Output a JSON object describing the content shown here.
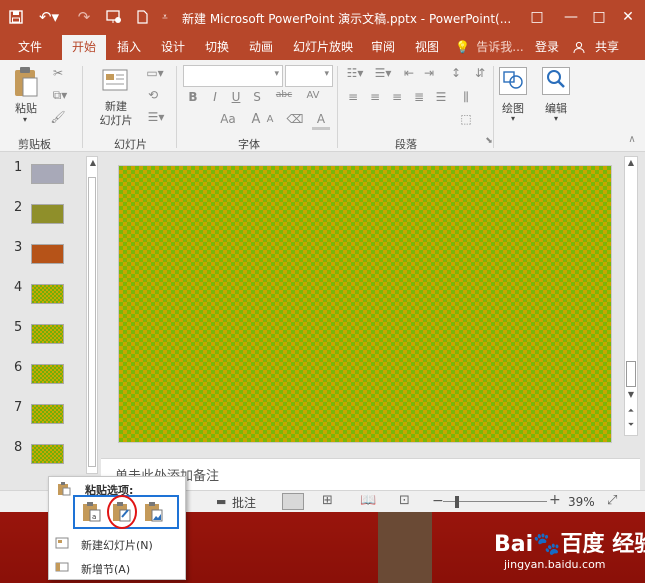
{
  "titlebar": {
    "title": "新建 Microsoft PowerPoint 演示文稿.pptx - PowerPoint(...",
    "window_buttons": [
      "□",
      "—",
      "□",
      "✕"
    ]
  },
  "tabs": [
    {
      "label": "文件"
    },
    {
      "label": "开始"
    },
    {
      "label": "插入"
    },
    {
      "label": "设计"
    },
    {
      "label": "切换"
    },
    {
      "label": "动画"
    },
    {
      "label": "幻灯片放映"
    },
    {
      "label": "审阅"
    },
    {
      "label": "视图"
    }
  ],
  "tell_me": "告诉我...",
  "login": "登录",
  "share": "共享",
  "ribbon": {
    "paste_label": "粘贴",
    "new_slide_label": "新建\n幻灯片",
    "drawing_label": "绘图",
    "editing_label": "编辑",
    "groups": {
      "clipboard": "剪贴板",
      "slides": "幻灯片",
      "font": "字体",
      "paragraph": "段落"
    },
    "font_buttons": [
      "B",
      "I",
      "U",
      "S",
      "abc",
      "AV",
      "Aa",
      "A",
      "A"
    ]
  },
  "thumbnails": [
    {
      "num": "1",
      "color": "#a8a9b8"
    },
    {
      "num": "2",
      "color": "#8f8f2a"
    },
    {
      "num": "3",
      "color": "#b65318"
    },
    {
      "num": "4",
      "color": "checker"
    },
    {
      "num": "5",
      "color": "checker"
    },
    {
      "num": "6",
      "color": "checker"
    },
    {
      "num": "7",
      "color": "checker"
    },
    {
      "num": "8",
      "color": "checker"
    }
  ],
  "notes_placeholder": "单击此处添加备注",
  "statusbar": {
    "notes_fragment": "注",
    "comments": "批注",
    "zoom": "39%"
  },
  "context_menu": {
    "title": "粘贴选项:",
    "items": [
      {
        "label": "新建幻灯片(N)"
      },
      {
        "label": "新增节(A)"
      }
    ]
  },
  "watermark": {
    "text": "Bai🐾百度 经验",
    "url": "jingyan.baidu.com"
  },
  "colors": {
    "accent": "#b7472a",
    "highlight_box": "#1e73d6",
    "highlight_circle": "#e01414"
  }
}
